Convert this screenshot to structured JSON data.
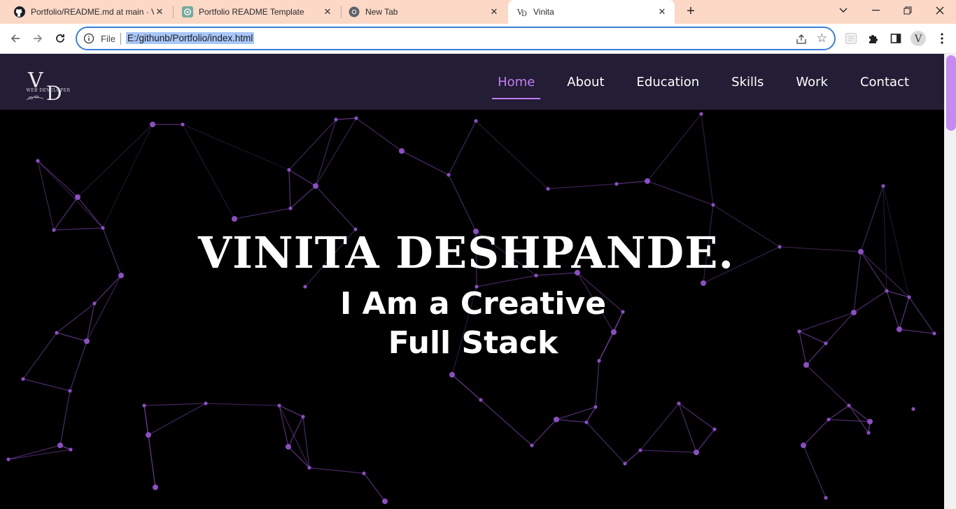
{
  "browser": {
    "tabs": [
      {
        "title": "Portfolio/README.md at main · V",
        "icon": "github-icon"
      },
      {
        "title": "Portfolio README Template",
        "icon": "chatgpt-icon"
      },
      {
        "title": "New Tab",
        "icon": "chrome-icon"
      },
      {
        "title": "Vinita",
        "icon": "vd-logo-icon",
        "active": true
      }
    ],
    "scheme_label": "File",
    "url": "E:/githunb/Portfolio/index.html",
    "profile_initial": "V"
  },
  "site": {
    "nav": [
      {
        "label": "Home",
        "active": true
      },
      {
        "label": "About"
      },
      {
        "label": "Education"
      },
      {
        "label": "Skills"
      },
      {
        "label": "Work"
      },
      {
        "label": "Contact"
      }
    ],
    "logo_text": "VD",
    "logo_caption": "WEB DEVELOPER",
    "hero_name": "VINITA DESHPANDE.",
    "hero_line1": "I Am a Creative",
    "hero_line2": "Full Stack"
  },
  "colors": {
    "accent": "#c47ef5",
    "navbar": "#231d35",
    "tabstrip": "#fcd8c7",
    "network": "#8a4fc0"
  }
}
